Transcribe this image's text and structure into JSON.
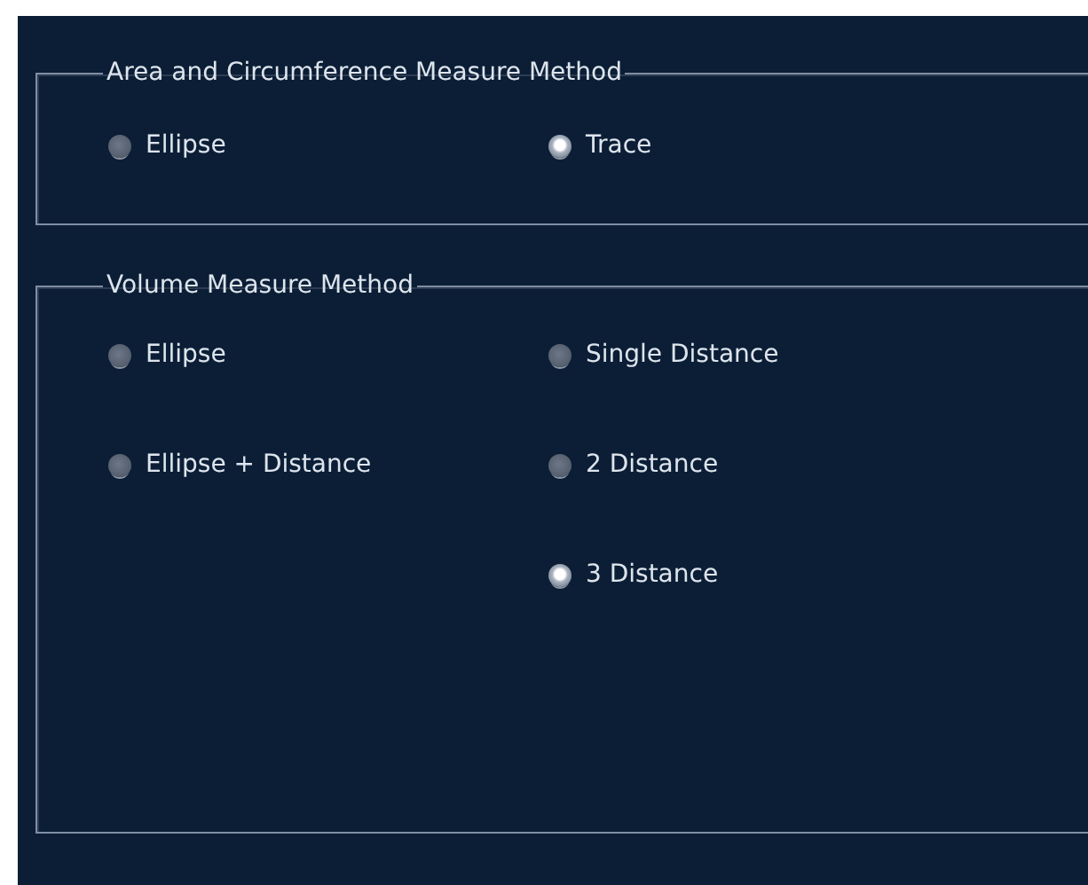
{
  "groups": [
    {
      "title": "Area and Circumference Measure Method",
      "columns": [
        [
          {
            "label": "Ellipse",
            "selected": false
          }
        ],
        [
          {
            "label": "Trace",
            "selected": true
          }
        ]
      ]
    },
    {
      "title": "Volume Measure Method",
      "columns": [
        [
          {
            "label": "Ellipse",
            "selected": false
          },
          {
            "label": "Ellipse + Distance",
            "selected": false
          }
        ],
        [
          {
            "label": "Single Distance",
            "selected": false
          },
          {
            "label": "2 Distance",
            "selected": false
          },
          {
            "label": "3 Distance",
            "selected": true
          }
        ]
      ]
    }
  ]
}
